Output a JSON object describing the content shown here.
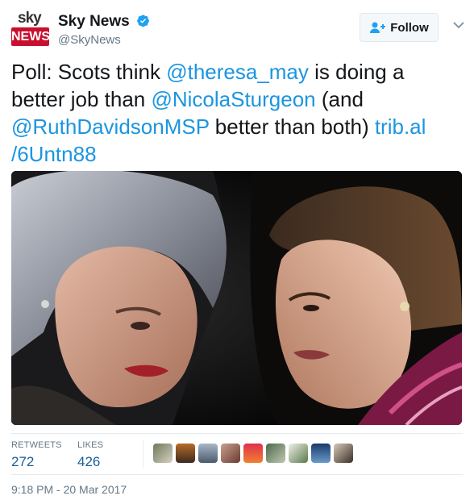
{
  "account": {
    "logo_top": "sky",
    "logo_bottom": "NEWS",
    "display_name": "Sky News",
    "handle": "@SkyNews",
    "follow_label": "Follow"
  },
  "tweet": {
    "segments": [
      {
        "text": "Poll: Scots think ",
        "link": false
      },
      {
        "text": "@theresa_may",
        "link": true
      },
      {
        "text": " is doing a better job than ",
        "link": false
      },
      {
        "text": "@NicolaSturgeon",
        "link": true
      },
      {
        "text": " (and ",
        "link": false
      },
      {
        "text": "@RuthDavidsonMSP",
        "link": true
      },
      {
        "text": " better than both) ",
        "link": false
      },
      {
        "text": "trib.al",
        "link": true
      },
      {
        "text": " ",
        "link": false
      },
      {
        "text": "/6Untn88",
        "link": true
      }
    ]
  },
  "stats": {
    "retweets_label": "RETWEETS",
    "retweets_value": "272",
    "likes_label": "LIKES",
    "likes_value": "426",
    "liker_avatar_count": 9
  },
  "timestamp": "9:18 PM - 20 Mar 2017",
  "colors": {
    "link": "#1b95e0",
    "brand_red": "#c8102e",
    "verified": "#1da1f2"
  }
}
